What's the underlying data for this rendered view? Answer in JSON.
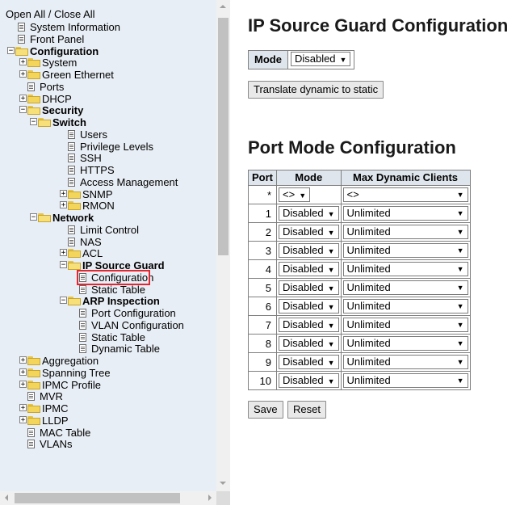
{
  "nav": {
    "open_close_all": "Open All / Close All",
    "items": [
      {
        "label": "System Information",
        "kind": "doc",
        "level": 1
      },
      {
        "label": "Front Panel",
        "kind": "doc",
        "level": 1
      },
      {
        "label": "Configuration",
        "kind": "folder-open",
        "level": 1,
        "bold": true,
        "expander": "-"
      },
      {
        "label": "System",
        "kind": "folder",
        "level": 2,
        "expander": "+"
      },
      {
        "label": "Green Ethernet",
        "kind": "folder",
        "level": 2,
        "expander": "+"
      },
      {
        "label": "Ports",
        "kind": "doc",
        "level": 2
      },
      {
        "label": "DHCP",
        "kind": "folder",
        "level": 2,
        "expander": "+"
      },
      {
        "label": "Security",
        "kind": "folder-open",
        "level": 2,
        "bold": true,
        "expander": "-"
      },
      {
        "label": "Switch",
        "kind": "folder-open",
        "level": 3,
        "bold": true,
        "expander": "-"
      },
      {
        "label": "Users",
        "kind": "doc",
        "level": 4
      },
      {
        "label": "Privilege Levels",
        "kind": "doc",
        "level": 4
      },
      {
        "label": "SSH",
        "kind": "doc",
        "level": 4
      },
      {
        "label": "HTTPS",
        "kind": "doc",
        "level": 4
      },
      {
        "label": "Access Management",
        "kind": "doc",
        "level": 4
      },
      {
        "label": "SNMP",
        "kind": "folder",
        "level": 4,
        "expander": "+"
      },
      {
        "label": "RMON",
        "kind": "folder",
        "level": 4,
        "expander": "+"
      },
      {
        "label": "Network",
        "kind": "folder-open",
        "level": 3,
        "bold": true,
        "expander": "-"
      },
      {
        "label": "Limit Control",
        "kind": "doc",
        "level": 4
      },
      {
        "label": "NAS",
        "kind": "doc",
        "level": 4
      },
      {
        "label": "ACL",
        "kind": "folder",
        "level": 4,
        "expander": "+"
      },
      {
        "label": "IP Source Guard",
        "kind": "folder-open",
        "level": 4,
        "bold": true,
        "expander": "-"
      },
      {
        "label": "Configuration",
        "kind": "doc",
        "level": 5,
        "selected": true
      },
      {
        "label": "Static Table",
        "kind": "doc",
        "level": 5
      },
      {
        "label": "ARP Inspection",
        "kind": "folder-open",
        "level": 4,
        "bold": true,
        "expander": "-"
      },
      {
        "label": "Port Configuration",
        "kind": "doc",
        "level": 5
      },
      {
        "label": "VLAN Configuration",
        "kind": "doc",
        "level": 5
      },
      {
        "label": "Static Table",
        "kind": "doc",
        "level": 5
      },
      {
        "label": "Dynamic Table",
        "kind": "doc",
        "level": 5
      },
      {
        "label": "Aggregation",
        "kind": "folder",
        "level": 2,
        "expander": "+"
      },
      {
        "label": "Spanning Tree",
        "kind": "folder",
        "level": 2,
        "expander": "+"
      },
      {
        "label": "IPMC Profile",
        "kind": "folder",
        "level": 2,
        "expander": "+"
      },
      {
        "label": "MVR",
        "kind": "doc",
        "level": 2
      },
      {
        "label": "IPMC",
        "kind": "folder",
        "level": 2,
        "expander": "+"
      },
      {
        "label": "LLDP",
        "kind": "folder",
        "level": 2,
        "expander": "+"
      },
      {
        "label": "MAC Table",
        "kind": "doc",
        "level": 2
      },
      {
        "label": "VLANs",
        "kind": "doc",
        "level": 2
      }
    ]
  },
  "main": {
    "title": "IP Source Guard Configuration",
    "mode_label": "Mode",
    "mode_value": "Disabled",
    "translate_button": "Translate dynamic to static",
    "port_section_title": "Port Mode Configuration",
    "table": {
      "headers": [
        "Port",
        "Mode",
        "Max Dynamic Clients"
      ],
      "rows": [
        {
          "port": "*",
          "mode": "<>",
          "max": "<>"
        },
        {
          "port": "1",
          "mode": "Disabled",
          "max": "Unlimited"
        },
        {
          "port": "2",
          "mode": "Disabled",
          "max": "Unlimited"
        },
        {
          "port": "3",
          "mode": "Disabled",
          "max": "Unlimited"
        },
        {
          "port": "4",
          "mode": "Disabled",
          "max": "Unlimited"
        },
        {
          "port": "5",
          "mode": "Disabled",
          "max": "Unlimited"
        },
        {
          "port": "6",
          "mode": "Disabled",
          "max": "Unlimited"
        },
        {
          "port": "7",
          "mode": "Disabled",
          "max": "Unlimited"
        },
        {
          "port": "8",
          "mode": "Disabled",
          "max": "Unlimited"
        },
        {
          "port": "9",
          "mode": "Disabled",
          "max": "Unlimited"
        },
        {
          "port": "10",
          "mode": "Disabled",
          "max": "Unlimited"
        }
      ]
    },
    "save_button": "Save",
    "reset_button": "Reset"
  },
  "colors": {
    "nav_background": "#e8eef5",
    "table_header_background": "#dfe5ec",
    "selection_outline": "#e3262f"
  }
}
